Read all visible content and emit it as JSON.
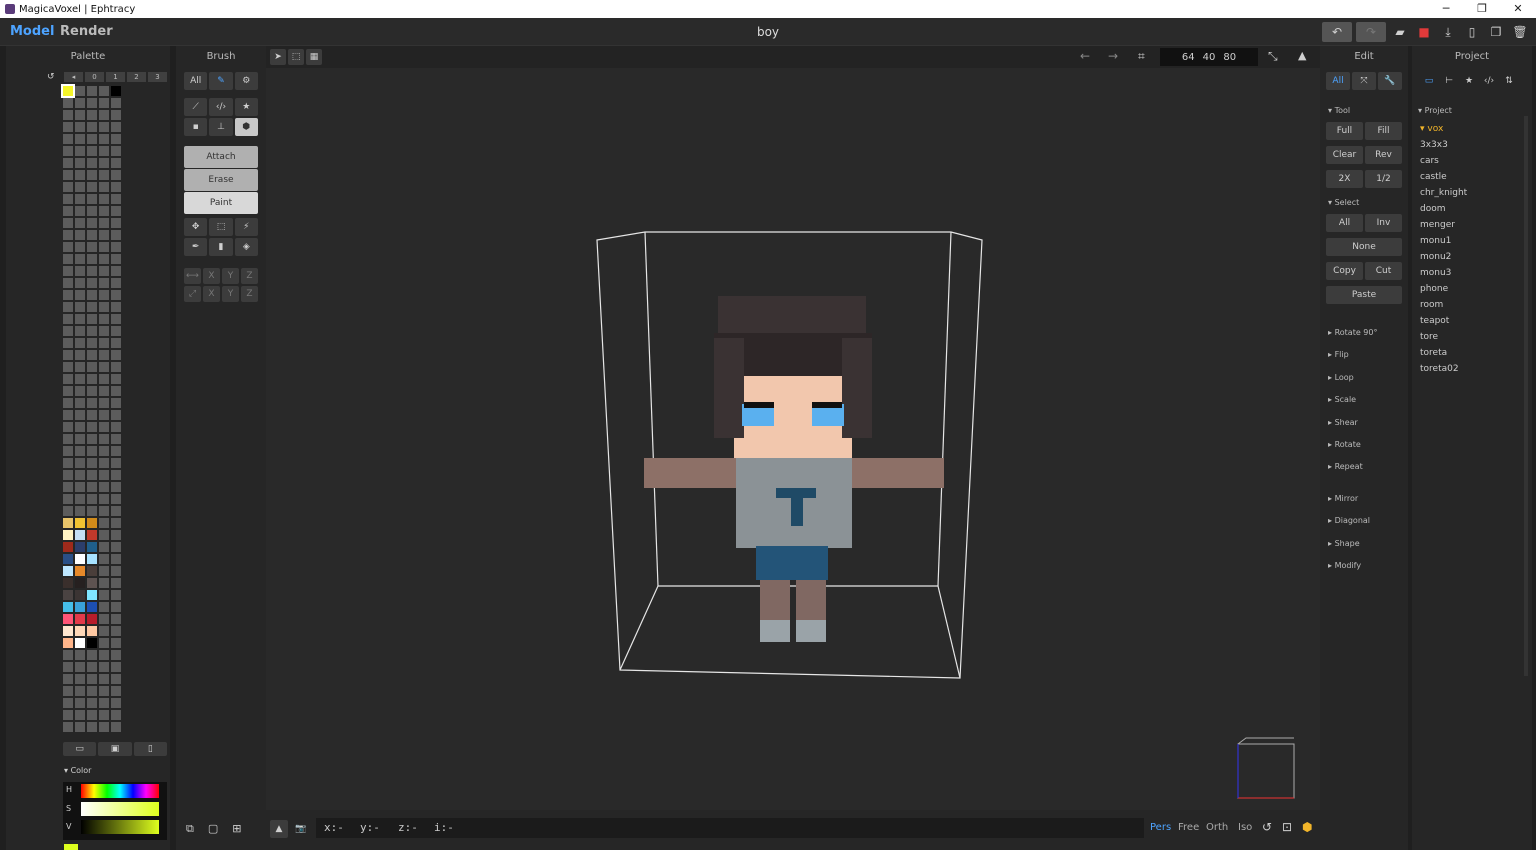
{
  "window": {
    "title": "MagicaVoxel | Ephtracy",
    "minimize": "─",
    "restore": "❐",
    "close": "✕"
  },
  "menubar": {
    "model_tab": "Model",
    "render_tab": "Render",
    "filename": "boy"
  },
  "palette": {
    "header": "Palette",
    "page_tabs": [
      "◂",
      "0",
      "1",
      "2",
      "3"
    ],
    "colors": [
      "#e9c46a",
      "#f1c232",
      "#d18b1a",
      "#fff3c4",
      "#c5dff5",
      "#c0392b",
      "#9e2a1b",
      "#2c3e6b",
      "#1f5f8b",
      "#2a4f86",
      "#ffffff",
      "#a7e2ff",
      "#bfe7ff",
      "#e6892a",
      "#4a3e3a",
      "#3a2f2c",
      "#262020",
      "#5e5351",
      "#4a4342",
      "#3b3433",
      "#7fe5ff",
      "#45bde8",
      "#3aa0d8",
      "#1d4fb2",
      "#ff5577",
      "#e23a4a",
      "#b71c2a",
      "#ffe7d0",
      "#ffd8b8",
      "#ffc9a3",
      "#ffb58a",
      "#ffffff",
      "#000000"
    ],
    "footer_icons": [
      "folder-icon",
      "save-icon",
      "file-icon"
    ]
  },
  "color_section": {
    "label": "Color",
    "h": "H",
    "s": "S",
    "v": "V",
    "rgb": "222 255 30"
  },
  "brush": {
    "header": "Brush",
    "all": "All",
    "modes": [
      "Attach",
      "Erase",
      "Paint"
    ],
    "axis_row1": [
      "X",
      "Y",
      "Z"
    ],
    "axis_row2": [
      "X",
      "Y",
      "Z"
    ]
  },
  "viewport": {
    "dims": [
      "64",
      "40",
      "80"
    ],
    "coords": {
      "x": "x:-",
      "y": "y:-",
      "z": "z:-",
      "i": "i:-"
    },
    "modes": [
      "Pers",
      "Free",
      "Orth",
      "Iso"
    ]
  },
  "edit": {
    "header": "Edit",
    "all": "All",
    "tool_section": "Tool",
    "tool_buttons": [
      [
        "Full",
        "Fill"
      ],
      [
        "Clear",
        "Rev"
      ],
      [
        "2X",
        "1/2"
      ]
    ],
    "select_section": "Select",
    "select_buttons": [
      [
        "All",
        "Inv"
      ]
    ],
    "none": "None",
    "copy": "Copy",
    "cut": "Cut",
    "paste": "Paste",
    "collapsed": [
      "Rotate 90°",
      "Flip",
      "Loop",
      "Scale",
      "Shear",
      "Rotate",
      "Repeat",
      "Mirror",
      "Diagonal",
      "Shape",
      "Modify"
    ]
  },
  "project": {
    "header": "Project",
    "section": "Project",
    "items": [
      "vox",
      "3x3x3",
      "cars",
      "castle",
      "chr_knight",
      "doom",
      "menger",
      "monu1",
      "monu2",
      "monu3",
      "phone",
      "room",
      "teapot",
      "tore",
      "toreta",
      "toreta02"
    ]
  }
}
